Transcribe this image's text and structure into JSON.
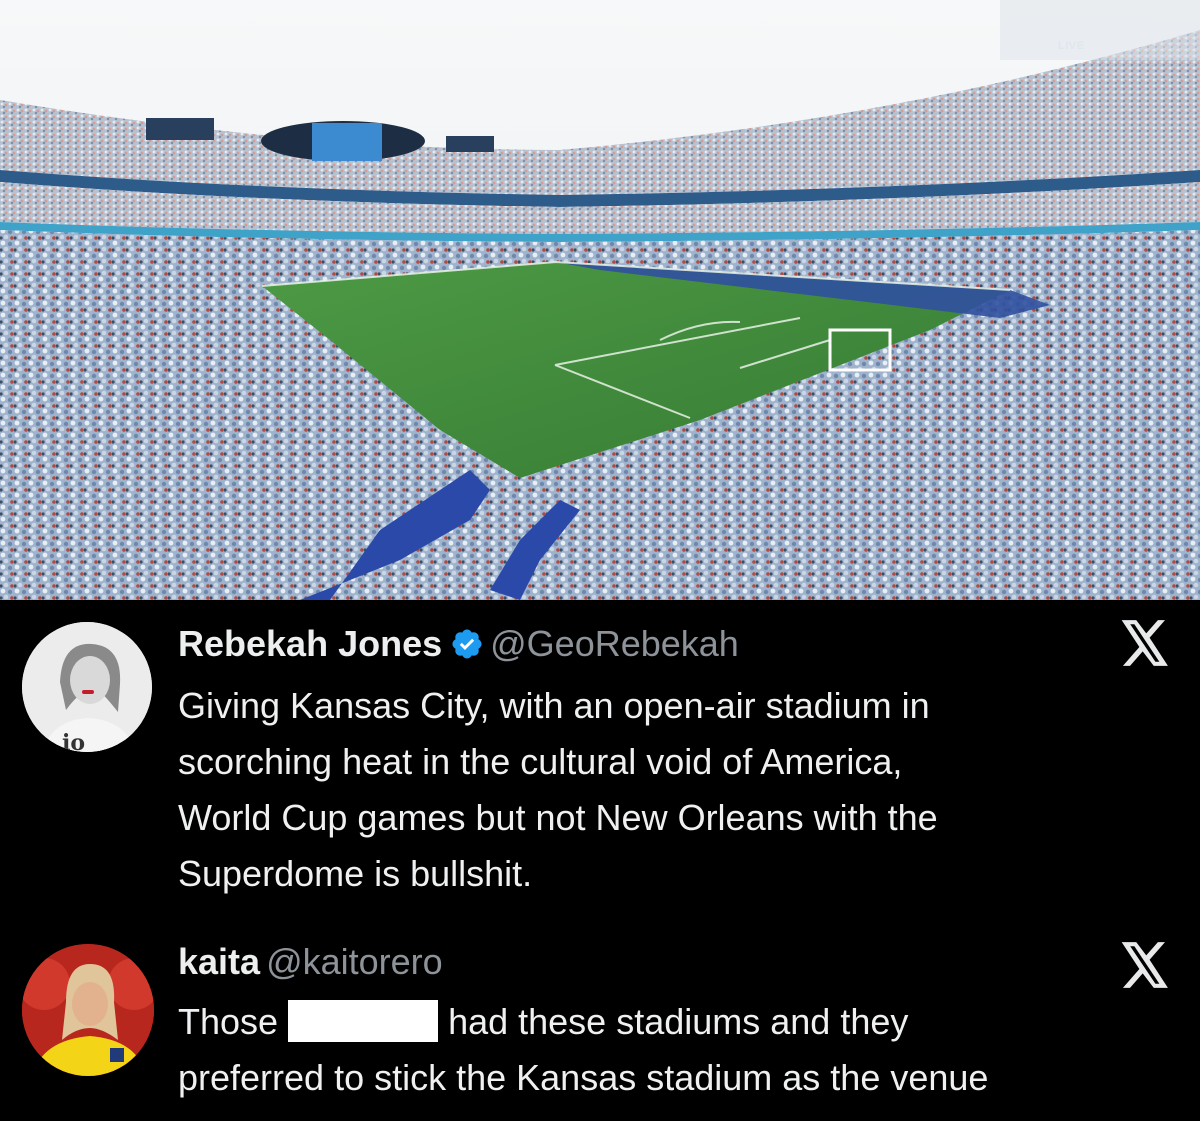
{
  "photo": {
    "live_badge": "LIVE"
  },
  "tweets": [
    {
      "display_name": "Rebekah Jones",
      "handle": "@GeoRebekah",
      "verified": true,
      "lines": [
        "Giving Kansas City, with an open-air stadium in",
        "scorching heat in the cultural void of America,",
        "World Cup games but not New Orleans with the",
        "Superdome is bullshit."
      ]
    },
    {
      "display_name": "kaita",
      "handle": "@kaitorero",
      "verified": false,
      "text_before_redaction": "Those",
      "text_after_redaction": "had these stadiums and they",
      "line_2": "preferred to stick the Kansas stadium as the venue"
    }
  ],
  "colors": {
    "background": "#000000",
    "text": "#e7e9ea",
    "handle": "#8d9399",
    "verified_badge": "#1d9bf0",
    "pitch": "#3f8a3a",
    "sky": "#f4f6f7"
  },
  "icons": {
    "x_logo": "x-logo-icon",
    "verified": "verified-badge-icon"
  }
}
